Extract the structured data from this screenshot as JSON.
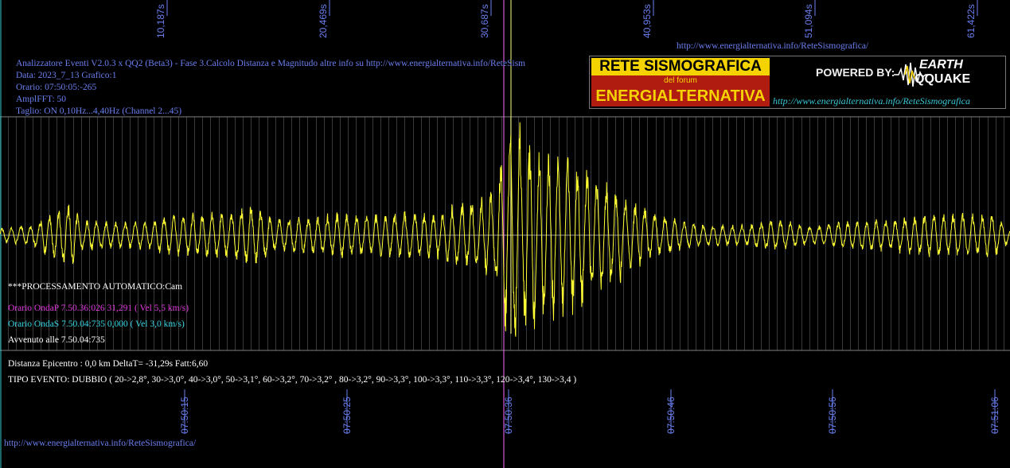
{
  "header": {
    "title": "Analizzatore Eventi V2.0.3 x QQ2 (Beta3) - Fase 3.Calcolo Distanza e Magnitudo altre info su http://www.energialternativa.info/ReteSism",
    "data": "Data: 2023_7_13 Grafico:1",
    "orario": "Orario: 07:50:05:-265",
    "amplfft": "AmplFFT: 50",
    "taglio": "Taglio: ON 0,10Hz...4,40Hz      (Channel 2...45)"
  },
  "top_url": "http://www.energialternativa.info/ReteSismografica/",
  "bottom_url": "http://www.energialternativa.info/ReteSismografica/",
  "logo": {
    "line1": "RETE SISMOGRAFICA",
    "line2": "del forum",
    "line3": "ENERGIALTERNATIVA",
    "powered": "POWERED BY:",
    "brand1": "EARTH",
    "brand2": "QQUAKE",
    "url": "http://www.energialternativa.info/ReteSismografica"
  },
  "processing": {
    "label": "***PROCESSAMENTO AUTOMATICO:Cam",
    "onda_p": "Orario OndaP 7.50.36:026  31,291  ( Vel 5,5 km/s)",
    "onda_s": "Orario OndaS 7.50.04:735  0,000  ( Vel 3,0 km/s)",
    "avvenuto": "Avvenuto alle 7.50.04:735",
    "distanza": "Distanza Epicentro : 0,0 km DeltaT= -31,29s  Fatt:6,60",
    "tipo_evento": "TIPO EVENTO: DUBBIO ( 20->2,8°, 30->3,0°, 40->3,0°, 50->3,1°, 60->3,2°, 70->3,2° , 80->3,2°, 90->3,3°, 100->3,3°, 110->3,3°, 120->3,4°, 130->3,4 )"
  },
  "colors": {
    "signal": "#ffff33",
    "grid": "#808080",
    "axis_text": "#6a7ff0",
    "p_marker": "#ff66ff",
    "s_marker": "#ffff80",
    "cyan_marker": "#33cccc"
  },
  "chart_data": {
    "type": "line",
    "top_tick_labels": [
      "10,187s",
      "20,469s",
      "30,687s",
      "40,953s",
      "51,094s",
      "61,422s"
    ],
    "bottom_tick_labels": [
      "07:50:15",
      "07:50:25",
      "07:50:36",
      "07:50:46",
      "07:50:56",
      "07:51:06"
    ],
    "x_range_seconds": [
      0,
      62.4
    ],
    "p_wave_time_s": 31.291,
    "s_wave_time_s": 0.0,
    "series": [
      {
        "envelope": [
          [
            0,
            10
          ],
          [
            2,
            14
          ],
          [
            3.5,
            35
          ],
          [
            4.3,
            45
          ],
          [
            5,
            22
          ],
          [
            7,
            18
          ],
          [
            9,
            20
          ],
          [
            11,
            28
          ],
          [
            14,
            30
          ],
          [
            15.5,
            42
          ],
          [
            17,
            22
          ],
          [
            19,
            25
          ],
          [
            21,
            30
          ],
          [
            23,
            27
          ],
          [
            25,
            32
          ],
          [
            27,
            30
          ],
          [
            28.5,
            45
          ],
          [
            29.5,
            48
          ],
          [
            30.5,
            60
          ],
          [
            31.3,
            140
          ],
          [
            32,
            150
          ],
          [
            33,
            120
          ],
          [
            34,
            110
          ],
          [
            35,
            105
          ],
          [
            36,
            95
          ],
          [
            37,
            75
          ],
          [
            38,
            68
          ],
          [
            39,
            45
          ],
          [
            40,
            35
          ],
          [
            42,
            20
          ],
          [
            44,
            14
          ],
          [
            46,
            14
          ],
          [
            48,
            22
          ],
          [
            50,
            12
          ],
          [
            52,
            18
          ],
          [
            55,
            22
          ],
          [
            58,
            30
          ],
          [
            60,
            28
          ],
          [
            61.5,
            28
          ],
          [
            62.4,
            10
          ]
        ],
        "frequency_hz": 1.6
      }
    ]
  }
}
